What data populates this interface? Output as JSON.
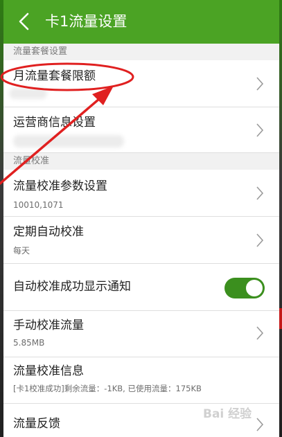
{
  "header": {
    "title": "卡1流量设置",
    "back_icon": "chevron-left-icon"
  },
  "sections": {
    "plan": "流量套餐设置",
    "calibration": "流量校准"
  },
  "rows": {
    "monthly_limit": {
      "title": "月流量套餐限额"
    },
    "carrier": {
      "title": "运营商信息设置"
    },
    "calib_params": {
      "title": "流量校准参数设置",
      "sub": "10010,1071"
    },
    "scheduled": {
      "title": "定期自动校准",
      "sub": "每天"
    },
    "notify": {
      "title": "自动校准成功显示通知",
      "toggle_on": true
    },
    "manual": {
      "title": "手动校准流量",
      "sub": "5.85MB"
    },
    "calib_info": {
      "title": "流量校准信息",
      "sub": "[卡1校准成功]剩余流量：-1KB, 已使用流量：175KB"
    },
    "feedback": {
      "title": "流量反馈"
    }
  },
  "watermark": "Bai 经验",
  "colors": {
    "header_green": "#4ba324",
    "toggle_green": "#3b8f1e",
    "annotation_red": "#e02020"
  }
}
